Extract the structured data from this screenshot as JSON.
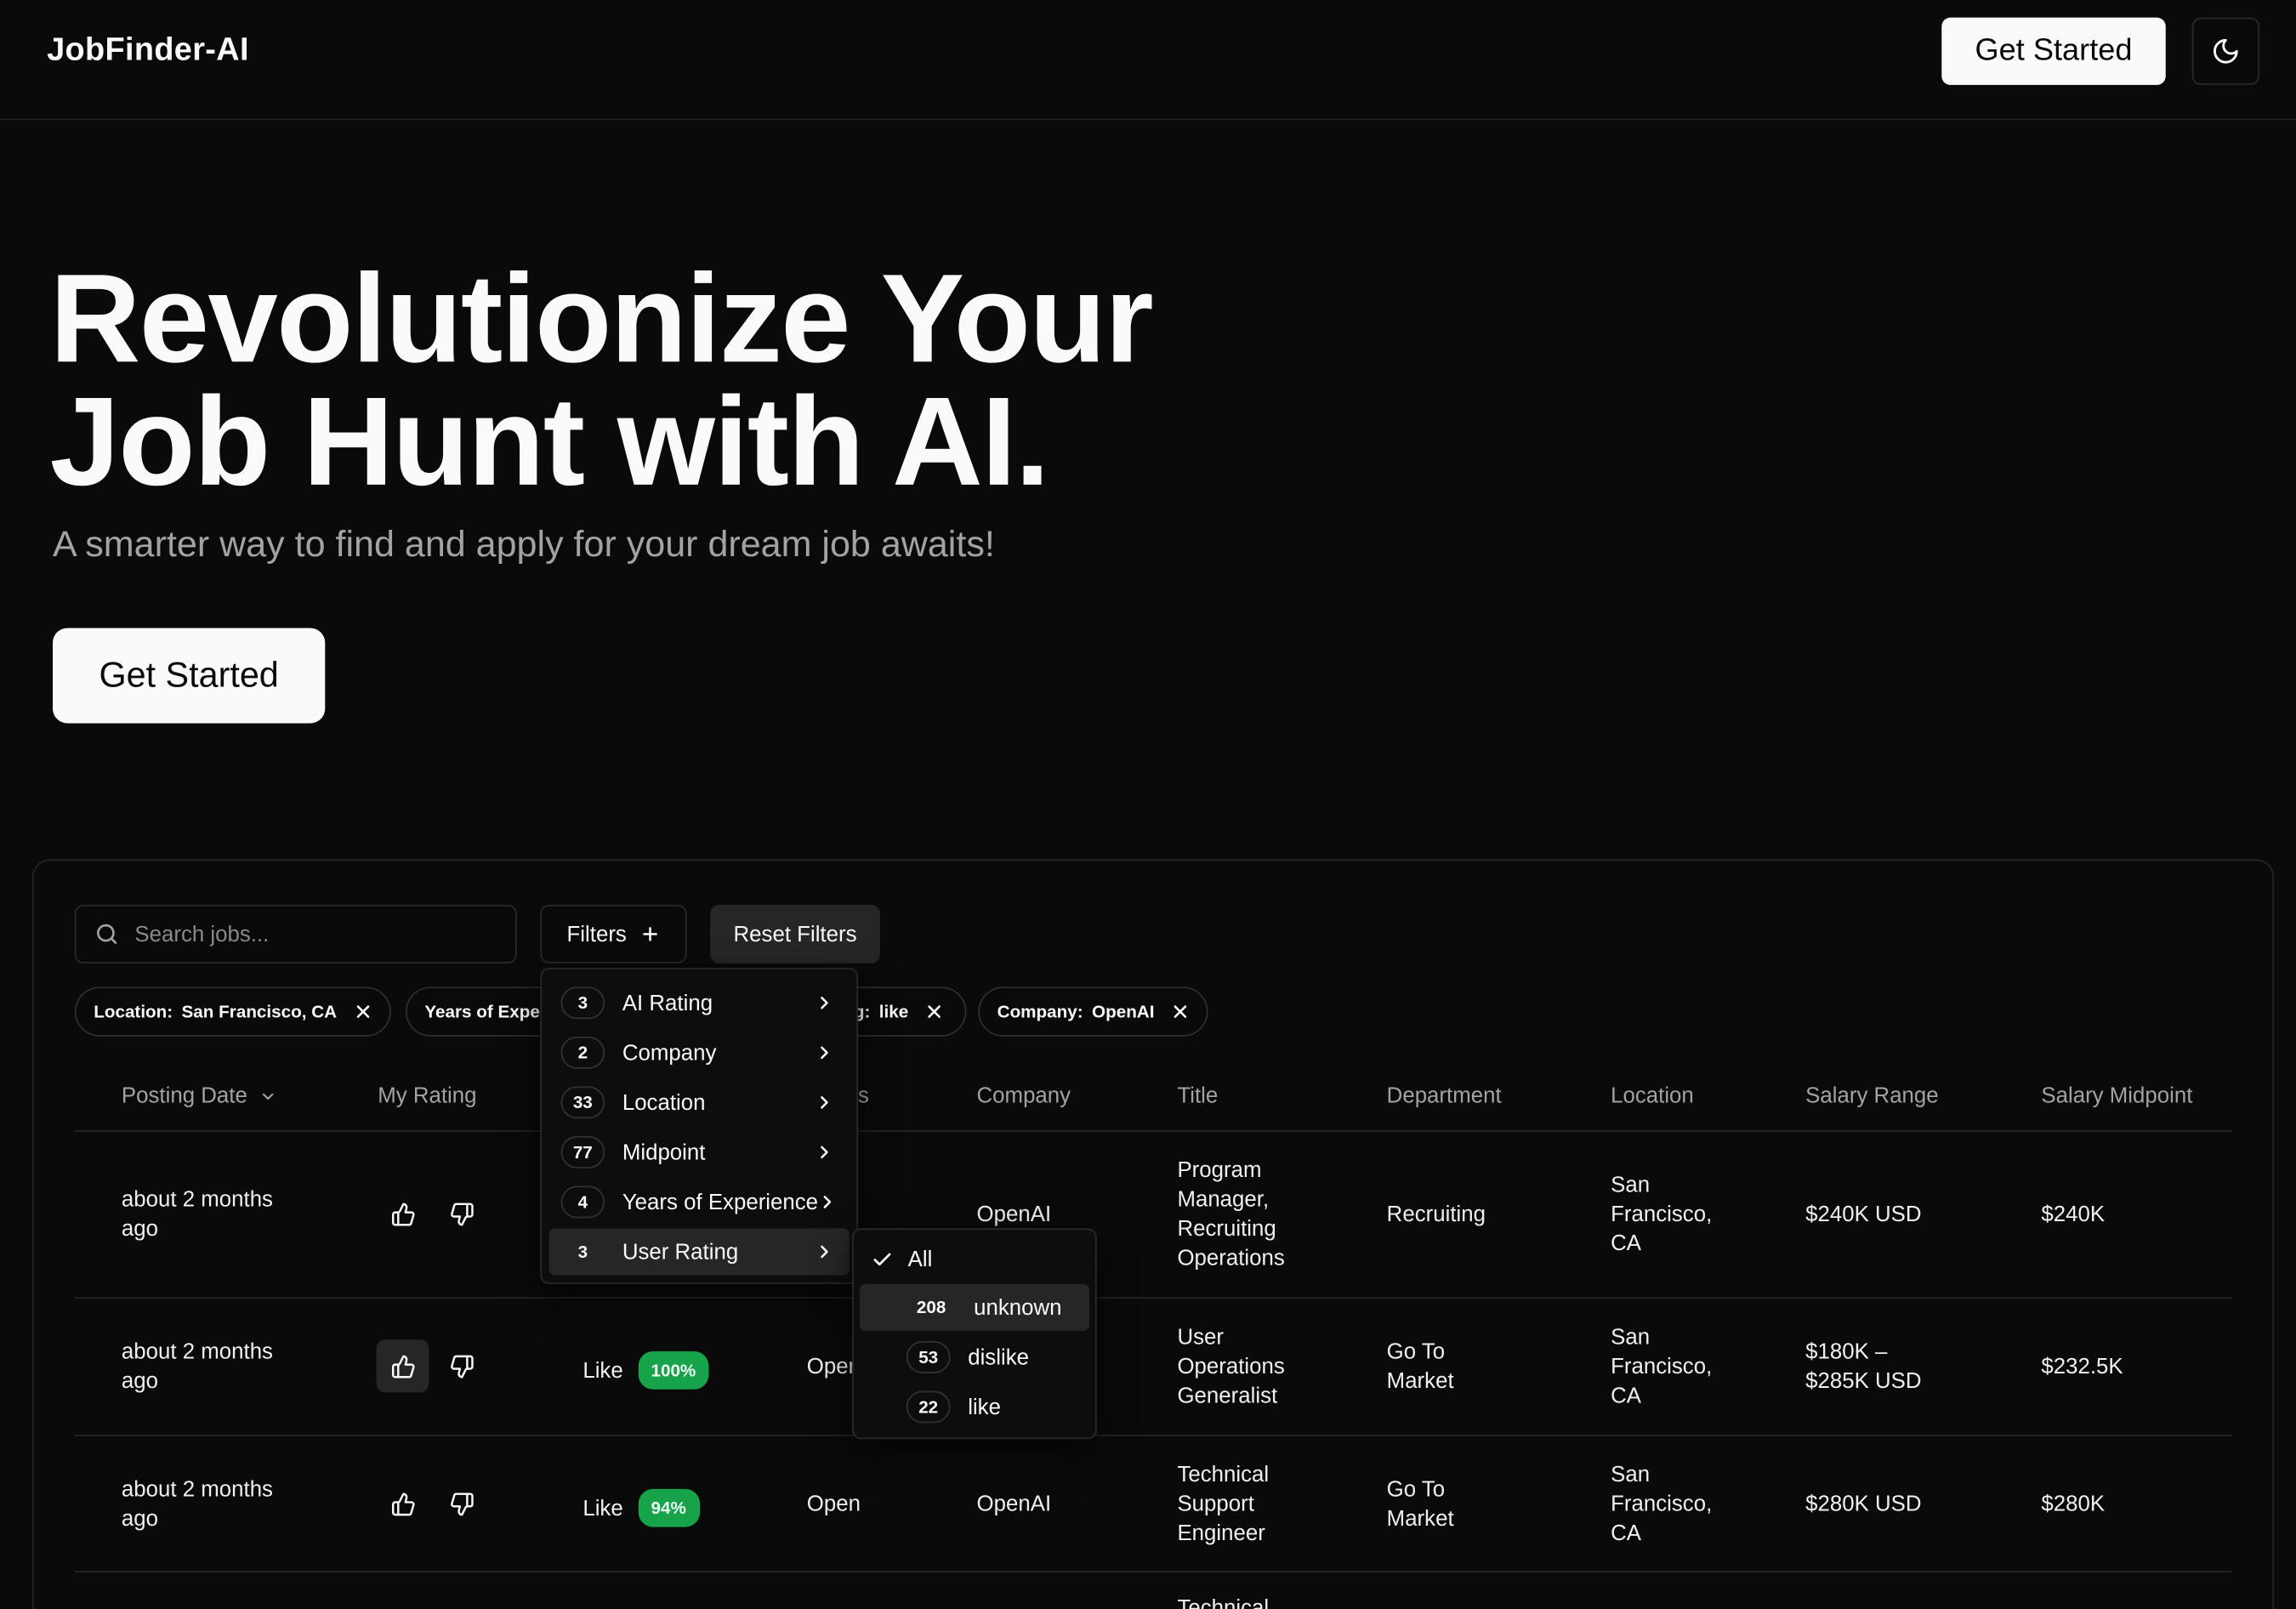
{
  "header": {
    "brand": "JobFinder-AI",
    "cta_label": "Get Started",
    "theme_icon": "moon-icon"
  },
  "hero": {
    "title_line1": "Revolutionize Your",
    "title_line2": "Job Hunt with AI.",
    "subtitle": "A smarter way to find and apply for your dream job awaits!",
    "cta_label": "Get Started"
  },
  "toolbar": {
    "search_placeholder": "Search jobs...",
    "filters_label": "Filters",
    "reset_label": "Reset Filters"
  },
  "chips": [
    {
      "key": "Location:",
      "value": "San Francisco, CA"
    },
    {
      "key": "Years of Expe",
      "value": ""
    },
    {
      "key": "g:",
      "value": "like"
    },
    {
      "key": "Company:",
      "value": "OpenAI"
    }
  ],
  "table": {
    "columns": [
      "Posting Date",
      "My Rating",
      "s",
      "Company",
      "Title",
      "Department",
      "Location",
      "Salary Range",
      "Salary Midpoint"
    ],
    "rows": [
      {
        "date": "about 2 months ago",
        "ai_rating": "",
        "ai_pct": "",
        "status": "",
        "company": "OpenAI",
        "title": "Program Manager, Recruiting Operations",
        "department": "Recruiting",
        "location": "San Francisco, CA",
        "salary_range": "$240K USD",
        "salary_mid": "$240K",
        "thumbs_up_active": false
      },
      {
        "date": "about 2 months ago",
        "ai_rating": "Like",
        "ai_pct": "100%",
        "status": "Open",
        "company": "",
        "title": "User Operations Generalist",
        "department": "Go To Market",
        "location": "San Francisco, CA",
        "salary_range": "$180K – $285K USD",
        "salary_mid": "$232.5K",
        "thumbs_up_active": true
      },
      {
        "date": "about 2 months ago",
        "ai_rating": "Like",
        "ai_pct": "94%",
        "status": "Open",
        "company": "OpenAI",
        "title": "Technical Support Engineer",
        "department": "Go To Market",
        "location": "San Francisco, CA",
        "salary_range": "$280K USD",
        "salary_mid": "$280K",
        "thumbs_up_active": false
      }
    ],
    "partial_row_title": "Technical"
  },
  "filter_menu": [
    {
      "count": "3",
      "label": "AI Rating"
    },
    {
      "count": "2",
      "label": "Company"
    },
    {
      "count": "33",
      "label": "Location"
    },
    {
      "count": "77",
      "label": "Midpoint"
    },
    {
      "count": "4",
      "label": "Years of Experience"
    },
    {
      "count": "3",
      "label": "User Rating"
    }
  ],
  "submenu": {
    "all_label": "All",
    "items": [
      {
        "count": "208",
        "label": "unknown"
      },
      {
        "count": "53",
        "label": "dislike"
      },
      {
        "count": "22",
        "label": "like"
      }
    ]
  },
  "colors": {
    "background": "#0a0a0a",
    "accent_green": "#16a34a",
    "button_light": "#fafafa"
  }
}
